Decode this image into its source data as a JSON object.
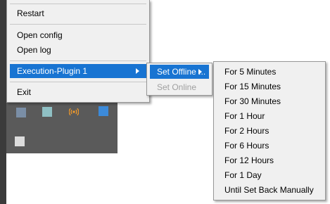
{
  "main_menu": {
    "items": [
      {
        "label": "Restart"
      },
      {
        "label": "Open config"
      },
      {
        "label": "Open log"
      },
      {
        "label": "Execution-Plugin 1"
      },
      {
        "label": "Exit"
      }
    ]
  },
  "plugin_submenu": {
    "items": [
      {
        "label": "Set Offline ..."
      },
      {
        "label": "Set Online"
      }
    ]
  },
  "offline_duration_menu": {
    "items": [
      {
        "label": "For 5 Minutes"
      },
      {
        "label": "For 15 Minutes"
      },
      {
        "label": "For 30 Minutes"
      },
      {
        "label": "For 1 Hour"
      },
      {
        "label": "For 2 Hours"
      },
      {
        "label": "For 6 Hours"
      },
      {
        "label": "For 12 Hours"
      },
      {
        "label": "For 1 Day"
      },
      {
        "label": "Until Set Back Manually"
      }
    ]
  },
  "tray_icons": [
    "blurred-app-icon",
    "blurred-app-icon",
    "wireless-signal-icon",
    "blurred-app-icon",
    "blurred-app-icon"
  ],
  "colors": {
    "highlight": "#1874d2",
    "menu_background": "#f0f0f0",
    "tray_background": "#5a5a5a",
    "disabled_text": "#a0a0a0"
  }
}
